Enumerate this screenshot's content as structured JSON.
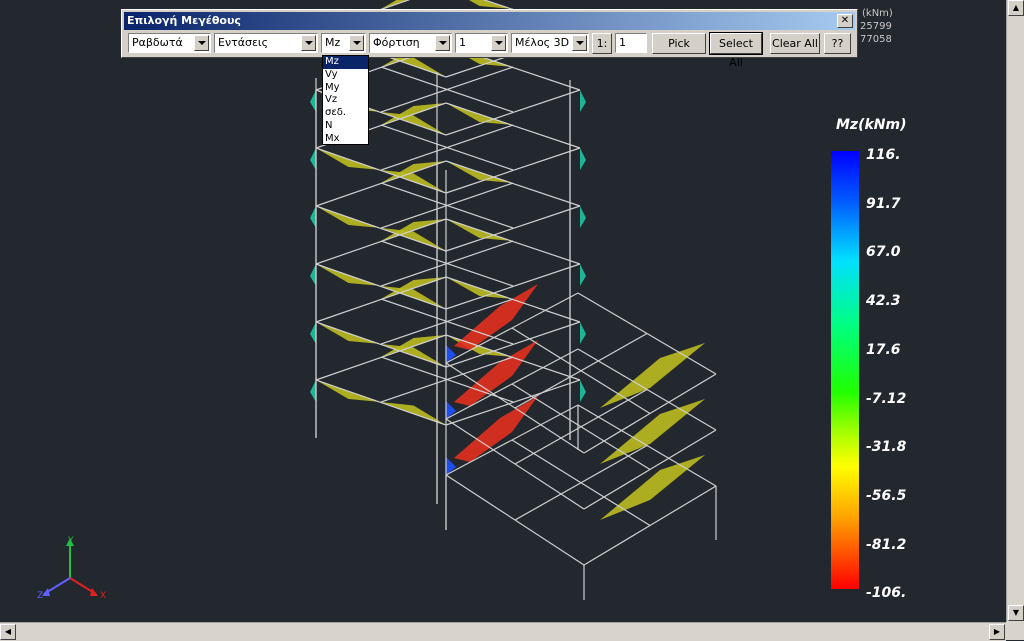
{
  "dialog": {
    "title": "Επιλογή Μεγέθους",
    "close_label": "✕",
    "element_type": "Ραβδωτά",
    "result_type": "Εντάσεις",
    "quantity": "Mz",
    "load": "Φόρτιση",
    "load_number": "1",
    "view_mode": "Μέλος 3D",
    "ratio_label": "1:",
    "ratio_value": "1",
    "pick_label": "Pick",
    "select_all_label": "Select All",
    "clear_all_label": "Clear All",
    "help_label": "??"
  },
  "quantity_options": [
    "Mz",
    "Vy",
    "My",
    "Vz",
    "σεδ.",
    "N",
    "Mx"
  ],
  "quantity_selected_index": 0,
  "behind_text": {
    "line1": "(kNm)",
    "line2": "25799",
    "line3": "77058"
  },
  "legend": {
    "title": "Mz(kNm)",
    "labels": [
      "116.",
      "91.7",
      "67.0",
      "42.3",
      "17.6",
      "-7.12",
      "-31.8",
      "-56.5",
      "-81.2",
      "-106."
    ]
  },
  "axes": {
    "x_label": "X",
    "y_label": "Y",
    "z_label": "Z",
    "x_color": "#e02020",
    "y_color": "#20c040",
    "z_color": "#6060ff"
  },
  "colors": {
    "background": "#23272e",
    "frame": "#d0d0d0",
    "diagram_default": "#b8b820",
    "diagram_high": "#e03020",
    "diagram_low": "#20c0a0"
  }
}
